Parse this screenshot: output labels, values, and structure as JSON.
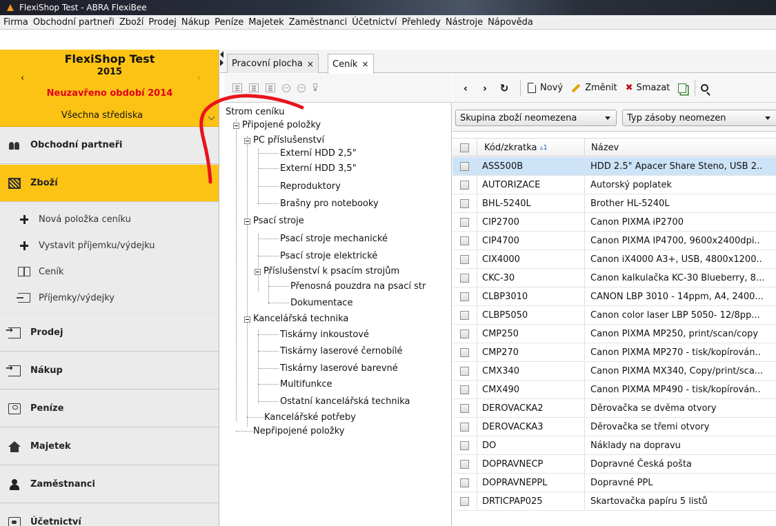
{
  "window": {
    "title": "FlexiShop Test - ABRA FlexiBee"
  },
  "menu": [
    "Firma",
    "Obchodní partneři",
    "Zboží",
    "Prodej",
    "Nákup",
    "Peníze",
    "Majetek",
    "Zaměstnanci",
    "Účetnictví",
    "Přehledy",
    "Nástroje",
    "Nápověda"
  ],
  "company": {
    "name": "FlexiShop Test",
    "year": "2015",
    "prev": "‹",
    "next": "›",
    "period": "Neuzavřeno období 2014",
    "centers": "Všechna střediska"
  },
  "nav": {
    "partners": "Obchodní partneři",
    "goods": "Zboží",
    "sub": [
      "Nová položka ceníku",
      "Vystavit příjemku/výdejku",
      "Ceník",
      "Příjemky/výdejky"
    ],
    "sales": "Prodej",
    "purchase": "Nákup",
    "money": "Peníze",
    "assets": "Majetek",
    "employees": "Zaměstnanci",
    "accounting": "Účetnictví"
  },
  "tabs": [
    "Pracovní plocha",
    "Ceník"
  ],
  "tab_close": "×",
  "tree": {
    "root": "Strom ceníku",
    "items": [
      "Připojené položky",
      "PC příslušenství",
      "Externí HDD 2,5\"",
      "Externí HDD 3,5\"",
      "Reproduktory",
      "Brašny pro notebooky",
      "Psací stroje",
      "Psací stroje mechanické",
      "Psací stroje elektrické",
      "Příslušenství k psacím strojům",
      "Přenosná pouzdra na psací str",
      "Dokumentace",
      "Kancelářská technika",
      "Tiskárny inkoustové",
      "Tiskárny laserové černobílé",
      "Tiskárny laserové barevné",
      "Multifunkce",
      "Ostatní kancelářská technika",
      "Kancelářské potřeby",
      "Nepřipojené položky"
    ]
  },
  "toolbar": {
    "back": "‹",
    "forward": "›",
    "refresh": "↻",
    "new": "Nový",
    "edit": "Změnit",
    "delete_glyph": "✖",
    "delete": "Smazat"
  },
  "filters": {
    "group": "Skupina zboží neomezena",
    "stock_type": "Typ zásoby neomezen"
  },
  "grid": {
    "headers": {
      "code": "Kód/zkratka",
      "sort": "▵1",
      "name": "Název"
    },
    "rows": [
      {
        "code": "ASS500B",
        "name": "HDD 2.5\" Apacer Share Steno, USB 2.."
      },
      {
        "code": "AUTORIZACE",
        "name": "Autorský poplatek"
      },
      {
        "code": "BHL-5240L",
        "name": "Brother HL-5240L"
      },
      {
        "code": "CIP2700",
        "name": "Canon PIXMA iP2700"
      },
      {
        "code": "CIP4700",
        "name": "Canon PIXMA IP4700, 9600x2400dpi.."
      },
      {
        "code": "CIX4000",
        "name": "Canon iX4000 A3+, USB, 4800x1200.."
      },
      {
        "code": "CKC-30",
        "name": "Canon kalkulačka KC-30 Blueberry, 8..."
      },
      {
        "code": "CLBP3010",
        "name": "CANON LBP 3010 - 14ppm, A4, 2400..."
      },
      {
        "code": "CLBP5050",
        "name": "Canon color laser LBP 5050- 12/8pp..."
      },
      {
        "code": "CMP250",
        "name": "Canon PIXMA MP250, print/scan/copy"
      },
      {
        "code": "CMP270",
        "name": "Canon PIXMA MP270 - tisk/kopírován.."
      },
      {
        "code": "CMX340",
        "name": "Canon PIXMA MX340, Copy/print/sca..."
      },
      {
        "code": "CMX490",
        "name": "Canon PIXMA MP490 - tisk/kopírován.."
      },
      {
        "code": "DEROVACKA2",
        "name": "Děrovačka se dvěma otvory"
      },
      {
        "code": "DEROVACKA3",
        "name": "Děrovačka se třemi otvory"
      },
      {
        "code": "DO",
        "name": "Náklady na dopravu"
      },
      {
        "code": "DOPRAVNECP",
        "name": "Dopravné Česká pošta"
      },
      {
        "code": "DOPRAVNEPPL",
        "name": "Dopravné PPL"
      },
      {
        "code": "DRTICPAP025",
        "name": "Skartovačka papíru 5 listů"
      }
    ]
  },
  "colors": {
    "accent": "#fcc314",
    "period_red": "#e2001a",
    "selection": "#cde3f7",
    "annotation": "#e8141c"
  }
}
